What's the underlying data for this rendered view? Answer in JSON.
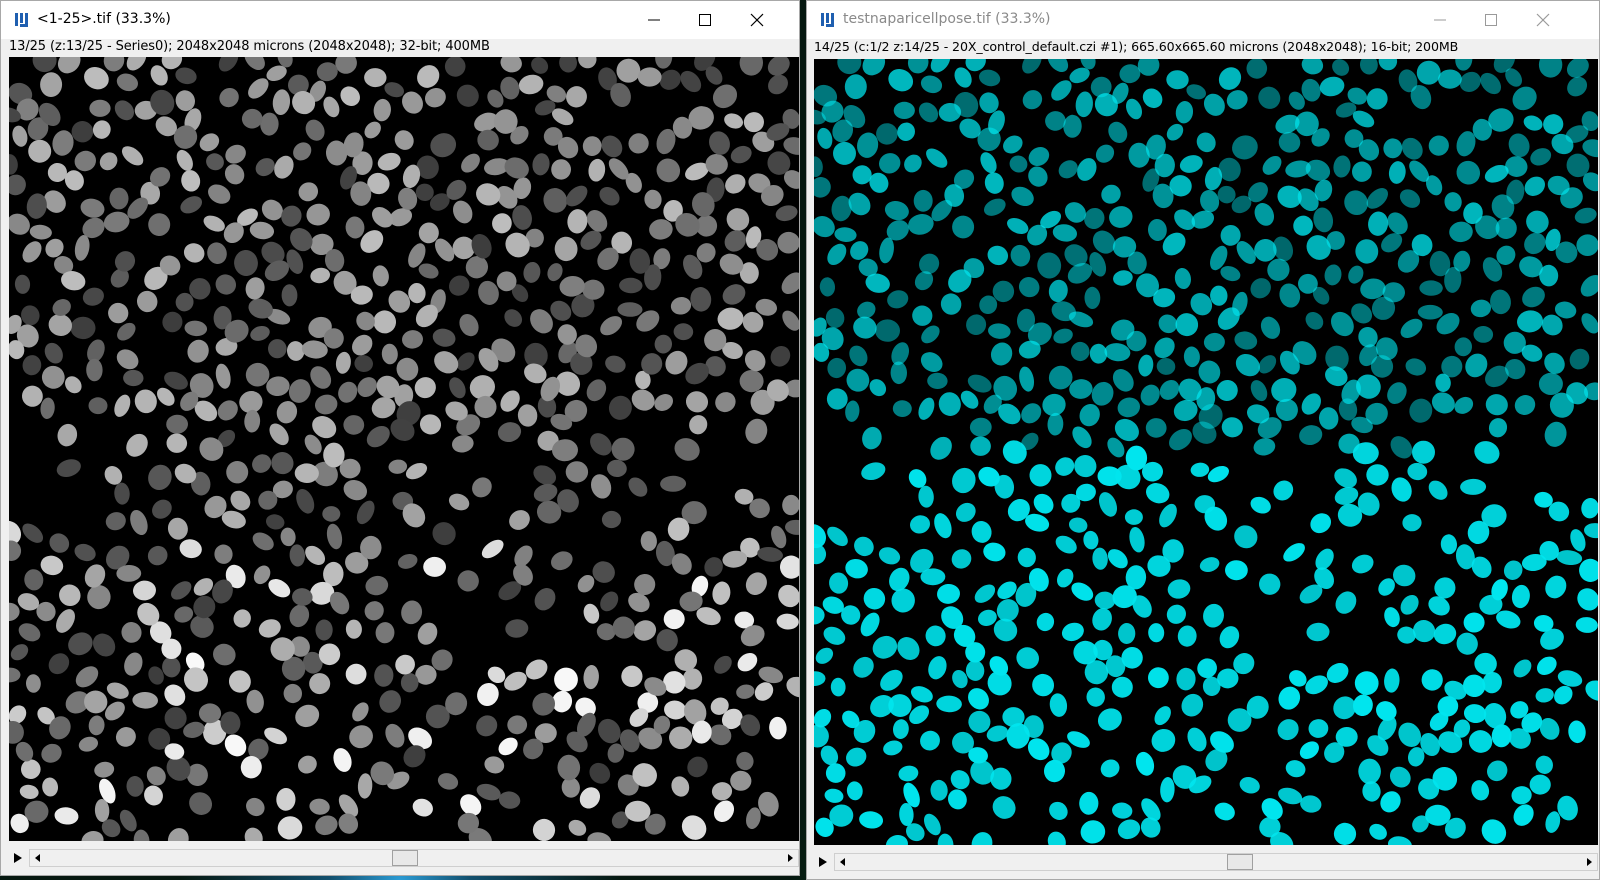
{
  "windows": [
    {
      "title": "<1-25>.tif (33.3%)",
      "info": "13/25 (z:13/25 - Series0); 2048x2048 microns (2048x2048); 32-bit; 400MB",
      "icon": "imagej-icon",
      "active": true,
      "image_colormap": "grayscale",
      "scroll_position": 0.5
    },
    {
      "title": "testnaparicellpose.tif (33.3%)",
      "info": "14/25 (c:1/2 z:14/25 - 20X_control_default.czi #1); 665.60x665.60 microns (2048x2048); 16-bit; 200MB",
      "icon": "imagej-icon",
      "active": false,
      "image_colormap": "cyan",
      "scroll_position": 0.54
    }
  ],
  "colors": {
    "cyan": "#00e5ee",
    "title_inactive": "#8a8a8a"
  }
}
